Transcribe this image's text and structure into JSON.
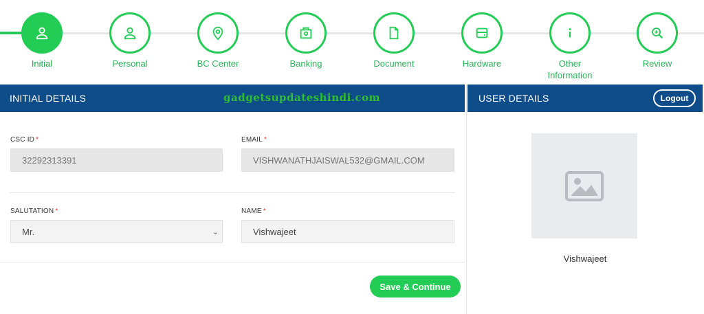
{
  "stepper": {
    "steps": [
      {
        "label": "Initial",
        "icon": "user-icon",
        "active": true
      },
      {
        "label": "Personal",
        "icon": "user-icon",
        "active": false
      },
      {
        "label": "BC Center",
        "icon": "location-pin-icon",
        "active": false
      },
      {
        "label": "Banking",
        "icon": "bank-icon",
        "active": false
      },
      {
        "label": "Document",
        "icon": "document-icon",
        "active": false
      },
      {
        "label": "Hardware",
        "icon": "printer-icon",
        "active": false
      },
      {
        "label": "Other Information",
        "icon": "info-icon",
        "active": false
      },
      {
        "label": "Review",
        "icon": "zoom-in-icon",
        "active": false
      }
    ]
  },
  "initial_details": {
    "title": "INITIAL DETAILS",
    "watermark": "gadgetsupdateshindi.com",
    "csc_id": {
      "label": "CSC ID",
      "required_mark": "*",
      "value": "32292313391"
    },
    "email": {
      "label": "EMAIL",
      "required_mark": "*",
      "value": "VISHWANATHJAISWAL532@GMAIL.COM"
    },
    "salutation": {
      "label": "SALUTATION",
      "required_mark": "*",
      "value": "Mr."
    },
    "name": {
      "label": "NAME",
      "required_mark": "*",
      "value": "Vishwajeet"
    },
    "save_label": "Save & Continue"
  },
  "user_details": {
    "title": "USER DETAILS",
    "logout_label": "Logout",
    "user_name": "Vishwajeet"
  },
  "colors": {
    "accent_green": "#22cc55",
    "header_blue": "#0f4c8a",
    "required_red": "#e53935"
  }
}
